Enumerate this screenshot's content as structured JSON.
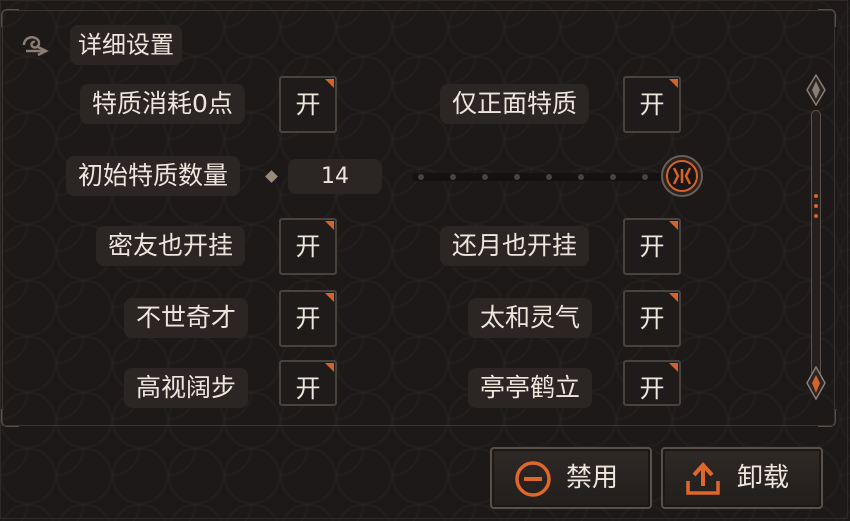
{
  "header": {
    "title": "详细设置",
    "icon": "settings-emblem-icon"
  },
  "toggles_left": [
    {
      "label": "特质消耗0点",
      "state": "开"
    },
    {
      "label": "密友也开挂",
      "state": "开"
    },
    {
      "label": "不世奇才",
      "state": "开"
    },
    {
      "label": "高视阔步",
      "state": "开"
    }
  ],
  "toggles_right": [
    {
      "label": "仅正面特质",
      "state": "开"
    },
    {
      "label": "还月也开挂",
      "state": "开"
    },
    {
      "label": "太和灵气",
      "state": "开"
    },
    {
      "label": "亭亭鹤立",
      "state": "开"
    }
  ],
  "slider": {
    "label": "初始特质数量",
    "value": "14",
    "position": 1.0
  },
  "footer": {
    "disable_label": "禁用",
    "unload_label": "卸载"
  },
  "colors": {
    "accent": "#d4632a",
    "background": "#1c1918",
    "panel": "#2b2624"
  }
}
